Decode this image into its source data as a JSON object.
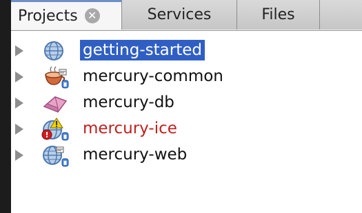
{
  "tabs": [
    {
      "label": "Projects",
      "active": true
    },
    {
      "label": "Services",
      "active": false
    },
    {
      "label": "Files",
      "active": false
    }
  ],
  "tree": {
    "nodes": [
      {
        "label": "getting-started",
        "icon": "web-project-icon",
        "state": "selected"
      },
      {
        "label": "mercury-common",
        "icon": "java-project-icon",
        "state": "normal"
      },
      {
        "label": "mercury-db",
        "icon": "db-project-icon",
        "state": "normal"
      },
      {
        "label": "mercury-ice",
        "icon": "web-project-warning-icon",
        "state": "error"
      },
      {
        "label": "mercury-web",
        "icon": "web-project-icon",
        "state": "normal"
      }
    ]
  },
  "colors": {
    "selection": "#2f5fc5",
    "error_text": "#c01f1f",
    "tab_accent": "#6d8fc6"
  }
}
